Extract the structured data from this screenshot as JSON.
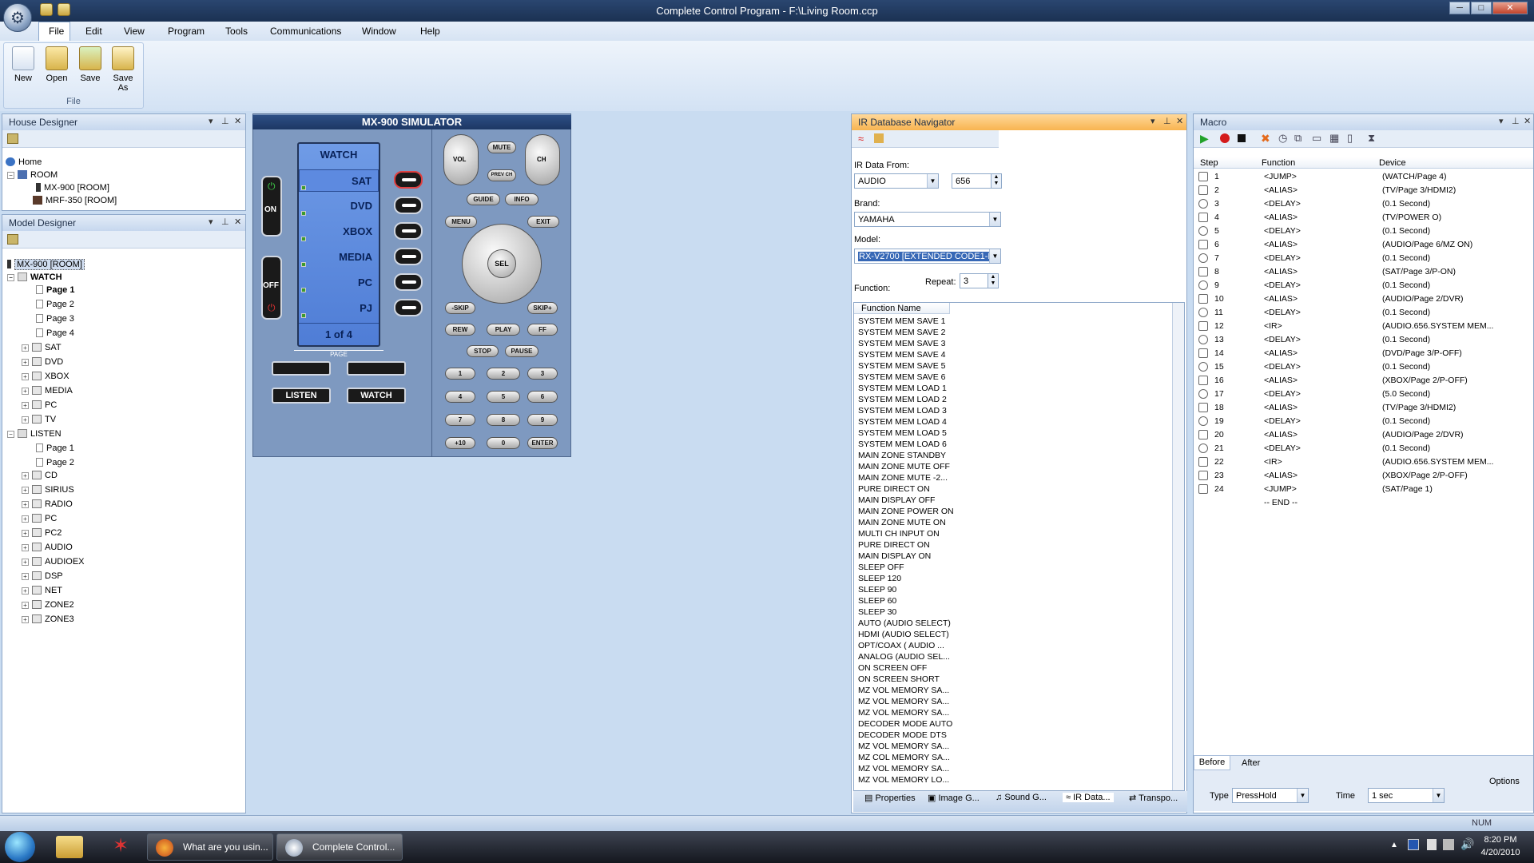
{
  "window": {
    "title": "Complete Control Program - F:\\Living Room.ccp",
    "controls": [
      "─",
      "□",
      "✕"
    ]
  },
  "menu": [
    "File",
    "Edit",
    "View",
    "Program",
    "Tools",
    "Communications",
    "Window",
    "Help"
  ],
  "ribbon": {
    "buttons": [
      "New",
      "Open",
      "Save",
      "Save As"
    ],
    "group_label": "File"
  },
  "house_designer": {
    "title": "House Designer",
    "items": [
      "Home",
      "ROOM",
      "MX-900 [ROOM]",
      "MRF-350 [ROOM]"
    ]
  },
  "model_designer": {
    "title": "Model Designer",
    "root": "MX-900 [ROOM]",
    "watch": "WATCH",
    "watch_pages": [
      "Page 1",
      "Page 2",
      "Page 3",
      "Page 4"
    ],
    "watch_devices": [
      "SAT",
      "DVD",
      "XBOX",
      "MEDIA",
      "PC",
      "TV"
    ],
    "listen": "LISTEN",
    "listen_pages": [
      "Page 1",
      "Page 2"
    ],
    "listen_devices": [
      "CD",
      "SIRIUS",
      "RADIO",
      "PC",
      "PC2",
      "AUDIO",
      "AUDIOEX",
      "DSP",
      "NET",
      "ZONE2",
      "ZONE3"
    ]
  },
  "simulator": {
    "title": "MX-900 SIMULATOR",
    "lcd_header": "WATCH",
    "lcd_items": [
      "SAT",
      "DVD",
      "XBOX",
      "MEDIA",
      "PC",
      "PJ"
    ],
    "lcd_footer": "1 of 4",
    "on": "ON",
    "off": "OFF",
    "page": "PAGE",
    "listen": "LISTEN",
    "watch": "WATCH",
    "buttons": {
      "vol": "VOL",
      "ch": "CH",
      "mute": "MUTE",
      "prev": "PREV CH",
      "guide": "GUIDE",
      "info": "INFO",
      "menu": "MENU",
      "exit": "EXIT",
      "sel": "SEL",
      "skipm": "-SKIP",
      "skipp": "SKIP+",
      "rew": "REW",
      "play": "PLAY",
      "ff": "FF",
      "stop": "STOP",
      "pause": "PAUSE",
      "n1": "1",
      "n2": "2",
      "n3": "3",
      "n4": "4",
      "n5": "5",
      "n6": "6",
      "n7": "7",
      "n8": "8",
      "n9": "9",
      "n10": "+10",
      "n0": "0",
      "enter": "ENTER"
    }
  },
  "ir_nav": {
    "title": "IR Database Navigator",
    "ir_from_label": "IR Data From:",
    "ir_from": "AUDIO",
    "code": "656",
    "brand_label": "Brand:",
    "brand": "YAMAHA",
    "model_label": "Model:",
    "model": "RX-V2700 [EXTENDED CODE1-MA",
    "function_label": "Function:",
    "repeat_label": "Repeat:",
    "repeat": "3",
    "column": "Function Name",
    "functions": [
      "SYSTEM MEM SAVE 1",
      "SYSTEM MEM SAVE 2",
      "SYSTEM MEM SAVE 3",
      "SYSTEM MEM SAVE 4",
      "SYSTEM MEM SAVE 5",
      "SYSTEM MEM SAVE 6",
      "SYSTEM MEM LOAD 1",
      "SYSTEM MEM LOAD 2",
      "SYSTEM MEM LOAD 3",
      "SYSTEM MEM LOAD 4",
      "SYSTEM MEM LOAD 5",
      "SYSTEM MEM LOAD 6",
      "MAIN ZONE STANDBY",
      "MAIN ZONE MUTE OFF",
      "MAIN ZONE MUTE -2...",
      "PURE DIRECT ON",
      "MAIN DISPLAY OFF",
      "MAIN ZONE POWER ON",
      "MAIN ZONE MUTE ON",
      "MULTI CH INPUT ON",
      "PURE DIRECT ON",
      "MAIN DISPLAY ON",
      "SLEEP OFF",
      "SLEEP 120",
      "SLEEP 90",
      "SLEEP 60",
      "SLEEP 30",
      "AUTO (AUDIO SELECT)",
      "HDMI (AUDIO SELECT)",
      "OPT/COAX ( AUDIO ...",
      "ANALOG (AUDIO SEL...",
      "ON SCREEN OFF",
      "ON SCREEN SHORT",
      "MZ VOL MEMORY SA...",
      "MZ VOL MEMORY SA...",
      "MZ VOL MEMORY SA...",
      "DECODER MODE AUTO",
      "DECODER MODE DTS",
      "MZ VOL MEMORY SA...",
      "MZ COL MEMORY SA...",
      "MZ VOL MEMORY SA...",
      "MZ VOL MEMORY LO..."
    ],
    "tabs": [
      "Properties",
      "Image G...",
      "Sound G...",
      "IR Data...",
      "Transpo..."
    ]
  },
  "macro": {
    "title": "Macro",
    "columns": [
      "Step",
      "Function",
      "Device"
    ],
    "rows": [
      [
        "1",
        "<JUMP>",
        "(WATCH/Page 4)"
      ],
      [
        "2",
        "<ALIAS>",
        "(TV/Page 3/HDMI2)"
      ],
      [
        "3",
        "<DELAY>",
        "(0.1 Second)"
      ],
      [
        "4",
        "<ALIAS>",
        "(TV/POWER O)"
      ],
      [
        "5",
        "<DELAY>",
        "(0.1 Second)"
      ],
      [
        "6",
        "<ALIAS>",
        "(AUDIO/Page 6/MZ ON)"
      ],
      [
        "7",
        "<DELAY>",
        "(0.1 Second)"
      ],
      [
        "8",
        "<ALIAS>",
        "(SAT/Page 3/P-ON)"
      ],
      [
        "9",
        "<DELAY>",
        "(0.1 Second)"
      ],
      [
        "10",
        "<ALIAS>",
        "(AUDIO/Page 2/DVR)"
      ],
      [
        "11",
        "<DELAY>",
        "(0.1 Second)"
      ],
      [
        "12",
        "<IR>",
        "(AUDIO.656.SYSTEM MEM..."
      ],
      [
        "13",
        "<DELAY>",
        "(0.1 Second)"
      ],
      [
        "14",
        "<ALIAS>",
        "(DVD/Page 3/P-OFF)"
      ],
      [
        "15",
        "<DELAY>",
        "(0.1 Second)"
      ],
      [
        "16",
        "<ALIAS>",
        "(XBOX/Page 2/P-OFF)"
      ],
      [
        "17",
        "<DELAY>",
        "(5.0 Second)"
      ],
      [
        "18",
        "<ALIAS>",
        "(TV/Page 3/HDMI2)"
      ],
      [
        "19",
        "<DELAY>",
        "(0.1 Second)"
      ],
      [
        "20",
        "<ALIAS>",
        "(AUDIO/Page 2/DVR)"
      ],
      [
        "21",
        "<DELAY>",
        "(0.1 Second)"
      ],
      [
        "22",
        "<IR>",
        "(AUDIO.656.SYSTEM MEM..."
      ],
      [
        "23",
        "<ALIAS>",
        "(XBOX/Page 2/P-OFF)"
      ],
      [
        "24",
        "<JUMP>",
        "(SAT/Page 1)"
      ]
    ],
    "end": "-- END --",
    "before": "Before",
    "after": "After",
    "options": "Options",
    "type_label": "Type",
    "type": "PressHold",
    "time_label": "Time",
    "time": "1 sec"
  },
  "status": {
    "num": "NUM"
  },
  "taskbar": {
    "items": [
      "What are you usin...",
      "Complete Control..."
    ],
    "time": "8:20 PM",
    "date": "4/20/2010"
  }
}
